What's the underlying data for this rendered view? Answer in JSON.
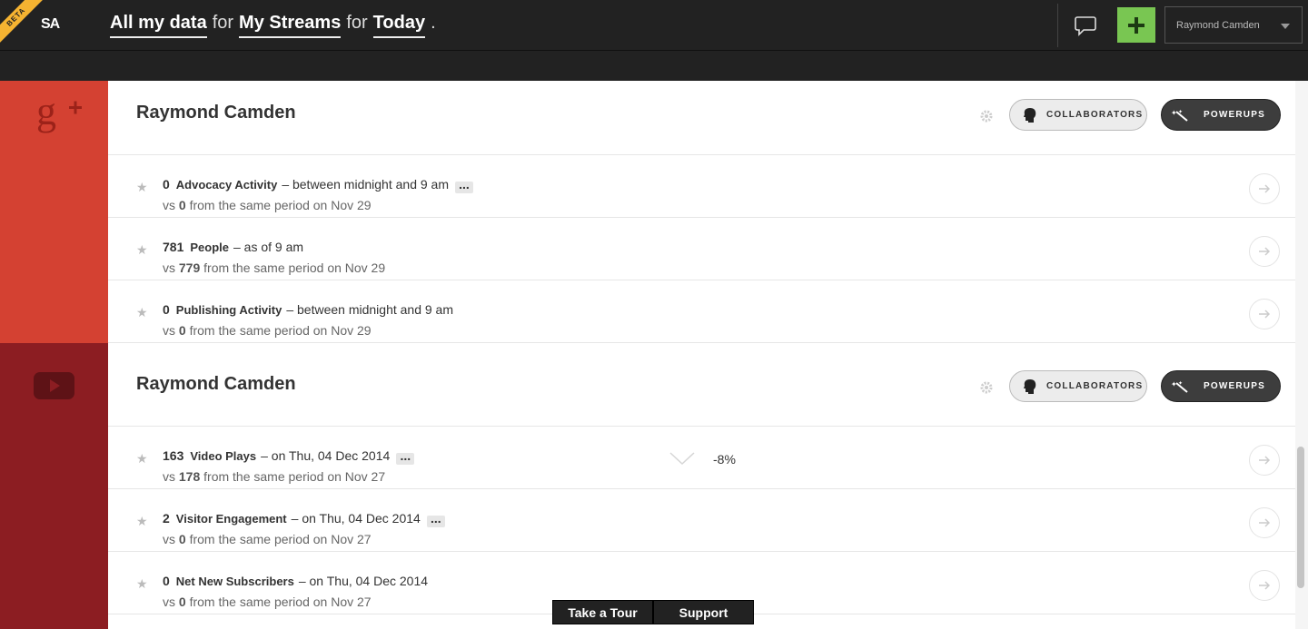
{
  "header": {
    "beta_label": "BETA",
    "logo_text": "SA",
    "breadcrumb": {
      "data_scope": "All my data",
      "joiner1": "for",
      "stream_scope": "My Streams",
      "joiner2": "for",
      "time_scope": "Today",
      "end": "."
    },
    "user_menu": {
      "selected": "Raymond Camden"
    },
    "icons": {
      "chat": "chat-bubble-icon",
      "add": "plus-icon",
      "caret": "chevron-down-icon"
    },
    "colors": {
      "bar": "#222222",
      "add_button": "#79c652",
      "beta_ribbon": "#f5b331"
    }
  },
  "streams": [
    {
      "service": "Google+",
      "service_icon": "google-plus-icon",
      "accent_color": "#d44132",
      "title": "Raymond Camden",
      "collaborators_label": "COLLABORATORS",
      "powerups_label": "POWERUPS",
      "metrics": [
        {
          "value": "0",
          "name": "Advocacy Activity",
          "desc": "– between midnight and 9 am",
          "has_more": true,
          "vs_prefix": "vs",
          "compare_value": "0",
          "compare_suffix": "from the same period on Nov 29"
        },
        {
          "value": "781",
          "name": "People",
          "desc": "– as of 9 am",
          "has_more": false,
          "vs_prefix": "vs",
          "compare_value": "779",
          "compare_suffix": "from the same period on Nov 29"
        },
        {
          "value": "0",
          "name": "Publishing Activity",
          "desc": "– between midnight and 9 am",
          "has_more": false,
          "vs_prefix": "vs",
          "compare_value": "0",
          "compare_suffix": "from the same period on Nov 29"
        }
      ]
    },
    {
      "service": "YouTube",
      "service_icon": "youtube-icon",
      "accent_color": "#8c1d22",
      "title": "Raymond Camden",
      "collaborators_label": "COLLABORATORS",
      "powerups_label": "POWERUPS",
      "metrics": [
        {
          "value": "163",
          "name": "Video Plays",
          "desc": "– on Thu, 04 Dec 2014",
          "has_more": true,
          "vs_prefix": "vs",
          "compare_value": "178",
          "compare_suffix": "from the same period on Nov 27",
          "trend": "down",
          "change": "-8%"
        },
        {
          "value": "2",
          "name": "Visitor Engagement",
          "desc": "– on Thu, 04 Dec 2014",
          "has_more": true,
          "vs_prefix": "vs",
          "compare_value": "0",
          "compare_suffix": "from the same period on Nov 27"
        },
        {
          "value": "0",
          "name": "Net New Subscribers",
          "desc": "– on Thu, 04 Dec 2014",
          "has_more": false,
          "vs_prefix": "vs",
          "compare_value": "0",
          "compare_suffix": "from the same period on Nov 27"
        }
      ]
    }
  ],
  "footer": {
    "tour_label": "Take a Tour",
    "support_label": "Support"
  }
}
